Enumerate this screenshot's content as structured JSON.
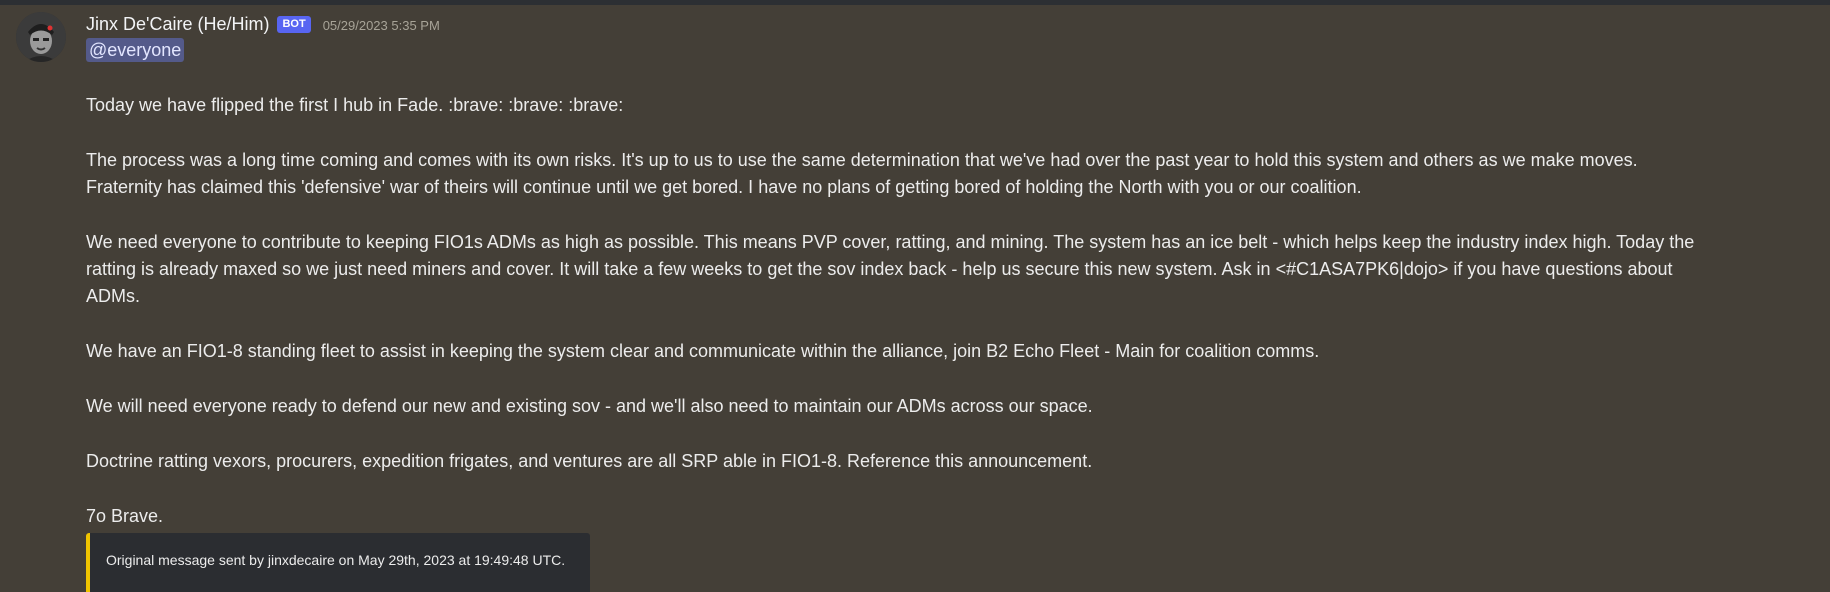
{
  "message": {
    "author": "Jinx De'Caire (He/Him)",
    "bot_badge": "BOT",
    "timestamp": "05/29/2023 5:35 PM",
    "mention": "@everyone",
    "paragraphs": [
      [
        "Today we have flipped the first I hub in Fade. :brave: :brave: :brave:"
      ],
      [
        "The process was a long time coming and comes with its own risks. It's up to us to use the same determination that we've had over the past year to hold this system and others as we make moves.",
        "Fraternity has claimed this 'defensive' war of theirs will continue until we get bored. I have no plans of getting bored of holding the North with you or our coalition."
      ],
      [
        "We need everyone to contribute to keeping FIO1s ADMs as high as possible. This means PVP cover, ratting, and mining. The system has an ice belt - which helps keep the industry index high. Today the",
        "ratting is already maxed so we just need miners and cover. It will take a few weeks to get the sov index back - help us secure this new system. Ask in <#C1ASA7PK6|dojo> if you have questions about",
        "ADMs."
      ],
      [
        "We have an FIO1-8 standing fleet to assist in keeping the system clear and communicate within the alliance, join B2 Echo Fleet - Main for coalition comms."
      ],
      [
        "We will need everyone ready to defend our new and existing sov - and we'll also need to maintain our ADMs across our space."
      ],
      [
        "Doctrine ratting vexors, procurers, expedition frigates, and ventures are all SRP able in FIO1-8. Reference this announcement."
      ],
      [
        "7o Brave."
      ]
    ]
  },
  "embed": {
    "text": "Original message sent by jinxdecaire on May 29th, 2023 at 19:49:48 UTC.",
    "accent_color": "#f0c400"
  },
  "colors": {
    "background": "#443f37",
    "bot_badge": "#5865f2",
    "mention_bg": "#545a8a"
  }
}
